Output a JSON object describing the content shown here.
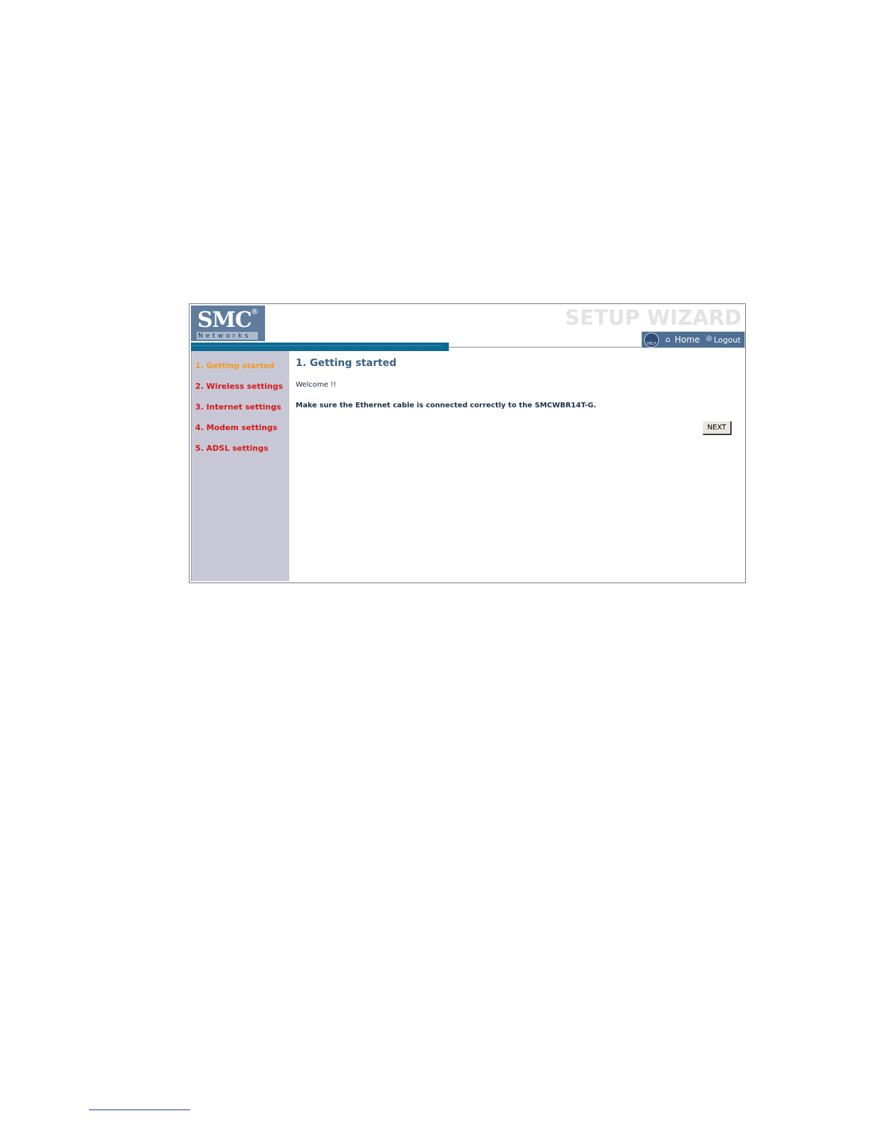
{
  "header": {
    "logo_text": "SMC",
    "logo_reg": "®",
    "logo_sub": "Networks",
    "wizard_title": "SETUP WIZARD",
    "help_label": "HELP",
    "home_label": "Home",
    "logout_label": "Logout",
    "icons": {
      "help": "help-globe-icon",
      "home": "home-icon",
      "logout": "logout-icon"
    }
  },
  "sidebar": {
    "items": [
      {
        "label": "1. Getting started",
        "active": true
      },
      {
        "label": "2. Wireless settings",
        "active": false
      },
      {
        "label": "3. Internet settings",
        "active": false
      },
      {
        "label": "4. Modem settings",
        "active": false
      },
      {
        "label": "5. ADSL settings",
        "active": false
      }
    ]
  },
  "main": {
    "title": "1. Getting started",
    "welcome": "Welcome !!",
    "instruction": "Make sure the Ethernet cable is connected correctly to the SMCWBR14T-G.",
    "next_label": "NEXT"
  },
  "colors": {
    "logo_bg": "#5f7c9d",
    "accent_bar": "#0e6a93",
    "sidebar_bg": "#c8c7d6",
    "menu_link": "#d51a1a",
    "menu_active": "#f29a1e",
    "title": "#3b5f86"
  }
}
